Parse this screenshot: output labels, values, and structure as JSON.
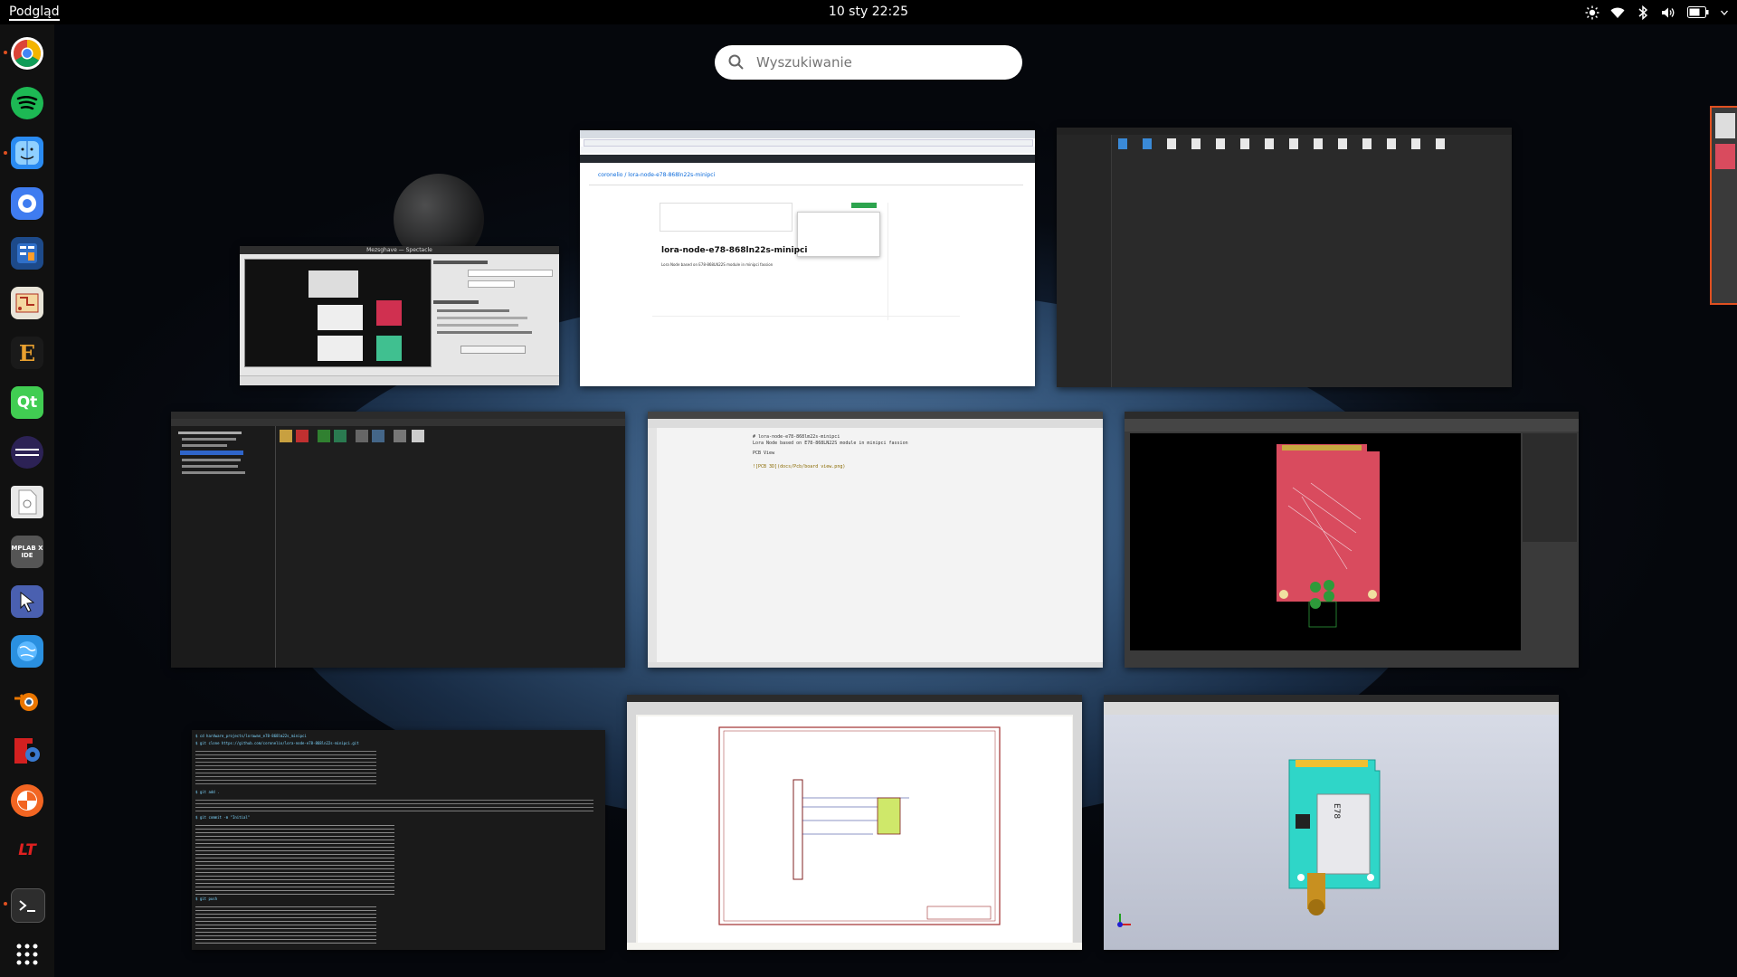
{
  "topbar": {
    "activities": "Podgląd",
    "clock": "10 sty  22:25"
  },
  "search": {
    "placeholder": "Wyszukiwanie"
  },
  "dock": [
    {
      "name": "chrome-icon"
    },
    {
      "name": "spotify-icon"
    },
    {
      "name": "finder-icon"
    },
    {
      "name": "chat-icon"
    },
    {
      "name": "calculator-icon"
    },
    {
      "name": "kicad-pcb-icon"
    },
    {
      "name": "e-app-icon"
    },
    {
      "name": "qt-icon"
    },
    {
      "name": "eclipse-icon"
    },
    {
      "name": "file-icon"
    },
    {
      "name": "mplab-icon"
    },
    {
      "name": "cursor-app-icon"
    },
    {
      "name": "globe-icon"
    },
    {
      "name": "blender-icon"
    },
    {
      "name": "freecad-icon"
    },
    {
      "name": "swirl-icon"
    },
    {
      "name": "lt-icon"
    },
    {
      "name": "terminal-icon"
    },
    {
      "name": "app-grid-icon"
    }
  ],
  "dock_labels": {
    "qt": "Qt",
    "e": "E",
    "mplab": "MPLAB X IDE",
    "lt": "LT"
  },
  "windows": {
    "screenshot": {
      "title": "Mezsghave — Spectacle"
    },
    "browser": {
      "repo_path": "coronelio / lora-node-e78-868ln22s-minipci",
      "readme_title": "lora-node-e78-868ln22s-minipci",
      "readme_desc": "Lora Node based on E78-868LN22S module in minipci fassion"
    },
    "editor": {
      "line1": "# lora-node-e78-868lm22s-minipci",
      "line2": "Lora Node based on E78-868LN22S module in minipci fassion",
      "line3": "PCB View",
      "line4": "![PCB 3D](docs/Pcb/board view.png)"
    },
    "terminal": {
      "cmd1": "$ cd hardware_projects/lorawan_e78-868lm22s_minipci",
      "cmd2": "$ git clone https://github.com/coronelio/lora-node-e78-868ln22s-minipci.git",
      "cmd3": "$ git add .",
      "cmd4": "$ git commit -m \"Initial\"",
      "cmd5": "$ git push"
    },
    "pcb3d": {
      "label": "E78"
    }
  }
}
